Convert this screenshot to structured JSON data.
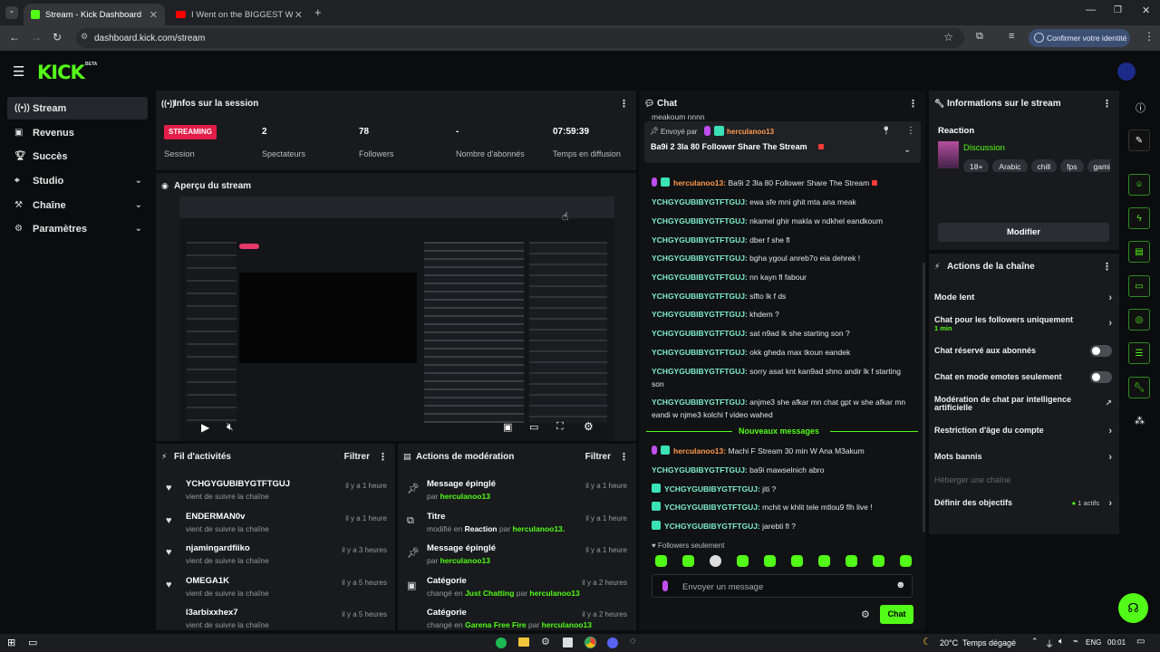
{
  "browser": {
    "tabs": [
      {
        "title": "Stream - Kick Dashboard"
      },
      {
        "title": "I Went on the BIGGEST Win Str"
      }
    ],
    "url": "dashboard.kick.com/stream",
    "confirm_button": "Confirmer votre identité"
  },
  "brand": {
    "logo": "KICK",
    "beta": "BETA",
    "accent": "#53fc18"
  },
  "sidebar": {
    "items": [
      {
        "label": "Stream",
        "icon": "broadcast-icon"
      },
      {
        "label": "Revenus",
        "icon": "wallet-icon"
      },
      {
        "label": "Succès",
        "icon": "trophy-icon"
      },
      {
        "label": "Studio",
        "icon": "studio-icon"
      },
      {
        "label": "Chaîne",
        "icon": "channel-icon"
      },
      {
        "label": "Paramètres",
        "icon": "gear-icon"
      }
    ]
  },
  "session": {
    "title": "Infos sur la session",
    "status": "STREAMING",
    "status_label": "Session",
    "stats": [
      {
        "value": "2",
        "label": "Spectateurs"
      },
      {
        "value": "78",
        "label": "Followers"
      },
      {
        "value": "-",
        "label": "Nombre d'abonnés"
      },
      {
        "value": "07:59:39",
        "label": "Temps en diffusion"
      }
    ]
  },
  "preview": {
    "title": "Aperçu du stream"
  },
  "activity": {
    "title": "Fil d'activités",
    "filter": "Filtrer",
    "rows": [
      {
        "name": "YCHGYGUBIBYGTFTGUJ",
        "sub": "vient de suivre la chaîne",
        "time": "il y a 1 heure"
      },
      {
        "name": "ENDERMAN0v",
        "sub": "vient de suivre la chaîne",
        "time": "il y a 1 heure"
      },
      {
        "name": "njamingardfiiko",
        "sub": "vient de suivre la chaîne",
        "time": "il y a 3 heures"
      },
      {
        "name": "OMEGA1K",
        "sub": "vient de suivre la chaîne",
        "time": "il y a 5 heures"
      },
      {
        "name": "l3arbixxhex7",
        "sub": "vient de suivre la chaîne",
        "time": "il y a 5 heures"
      }
    ]
  },
  "moderation": {
    "title": "Actions de modération",
    "filter": "Filtrer",
    "rows": [
      {
        "name": "Message épinglé",
        "pre": "par ",
        "user": "herculanoo13",
        "mid": "",
        "extra": "",
        "time": "il y a 1 heure"
      },
      {
        "name": "Titre",
        "pre": "modifié en ",
        "user": "Reaction",
        "mid": " par ",
        "extra": "herculanoo13.",
        "time": "il y a 1 heure"
      },
      {
        "name": "Message épinglé",
        "pre": "par ",
        "user": "herculanoo13",
        "mid": "",
        "extra": "",
        "time": "il y a 1 heure"
      },
      {
        "name": "Catégorie",
        "pre": "changé en ",
        "user": "Just Chatting",
        "mid": " par ",
        "extra": "herculanoo13",
        "time": "il y a 2 heures"
      },
      {
        "name": "Catégorie",
        "pre": "changé en ",
        "user": "Garena Free Fire",
        "mid": " par ",
        "extra": "herculanoo13",
        "time": "il y a 2 heures"
      }
    ]
  },
  "chat": {
    "title": "Chat",
    "top_cut": "meakoum nnnn",
    "pinned": {
      "sent_by": "Envoyé par",
      "user": "herculanoo13",
      "message": "Ba9i 2 3la 80 Follower Share The Stream"
    },
    "messages": [
      {
        "user": "herculanoo13:",
        "text": "Ba9i 2 3la 80 Follower Share The Stream",
        "owner": true
      },
      {
        "user": "YCHGYGUBIBYGTFTGUJ:",
        "text": "ewa sfe mni ghit mta ana meak"
      },
      {
        "user": "YCHGYGUBIBYGTFTGUJ:",
        "text": "nkamel ghir makla w ndkhel eandkoum"
      },
      {
        "user": "YCHGYGUBIBYGTFTGUJ:",
        "text": "dber f she fl"
      },
      {
        "user": "YCHGYGUBIBYGTFTGUJ:",
        "text": "bgha ygoul anreb7o eia dehrek !"
      },
      {
        "user": "YCHGYGUBIBYGTFTGUJ:",
        "text": "nn kayn fl fabour"
      },
      {
        "user": "YCHGYGUBIBYGTFTGUJ:",
        "text": "slfto lk f ds"
      },
      {
        "user": "YCHGYGUBIBYGTFTGUJ:",
        "text": "khdem ?"
      },
      {
        "user": "YCHGYGUBIBYGTFTGUJ:",
        "text": "sat n9ad lk she starting son ?"
      },
      {
        "user": "YCHGYGUBIBYGTFTGUJ:",
        "text": "okk gheda max tkoun eandek"
      },
      {
        "user": "YCHGYGUBIBYGTFTGUJ:",
        "text": "sorry asat knt kan9ad shno andir lk f starting son"
      },
      {
        "user": "YCHGYGUBIBYGTFTGUJ:",
        "text": "anjme3 she afkar mn chat gpt w she afkar mn eandi w njme3 kolchi f video wahed"
      }
    ],
    "new_messages": "Nouveaux messages",
    "messages2": [
      {
        "user": "herculanoo13:",
        "text": "Machi F Stream 30 min W Ana M3akum",
        "owner": true
      },
      {
        "user": "YCHGYGUBIBYGTFTGUJ:",
        "text": "ba9i mawselnich abro"
      },
      {
        "user": "YCHGYGUBIBYGTFTGUJ:",
        "text": "jiti ?"
      },
      {
        "user": "YCHGYGUBIBYGTFTGUJ:",
        "text": "mchit w khlit tele mtlou9 flh live !"
      },
      {
        "user": "YCHGYGUBIBYGTFTGUJ:",
        "text": "jarebti fl ?"
      }
    ],
    "followers_only": "Followers seulement",
    "input_placeholder": "Envoyer un message",
    "send": "Chat"
  },
  "stream_info": {
    "title": "Informations sur le stream",
    "stream_title": "Reaction",
    "category": "Discussion",
    "tags": [
      "18+",
      "Arabic",
      "chill",
      "fps",
      "gaming"
    ],
    "edit": "Modifier"
  },
  "channel_actions": {
    "title": "Actions de la chaîne",
    "items": [
      {
        "label": "Mode lent",
        "kind": "chevron"
      },
      {
        "label": "Chat pour les followers uniquement",
        "sub": "1 min",
        "kind": "chevron"
      },
      {
        "label": "Chat réservé aux abonnés",
        "kind": "toggle"
      },
      {
        "label": "Chat en mode emotes seulement",
        "kind": "toggle"
      },
      {
        "label": "Modération de chat par intelligence artificielle",
        "kind": "external"
      },
      {
        "label": "Restriction d'âge du compte",
        "kind": "chevron"
      },
      {
        "label": "Mots bannis",
        "kind": "chevron"
      },
      {
        "label": "Héberger une chaîne",
        "kind": "disabled"
      },
      {
        "label": "Définir des objectifs",
        "badge": "1 actifs",
        "kind": "chevron"
      }
    ]
  },
  "taskbar": {
    "weather": "20°C  Temps dégagé",
    "lang": "ENG",
    "clock": "00:01"
  }
}
